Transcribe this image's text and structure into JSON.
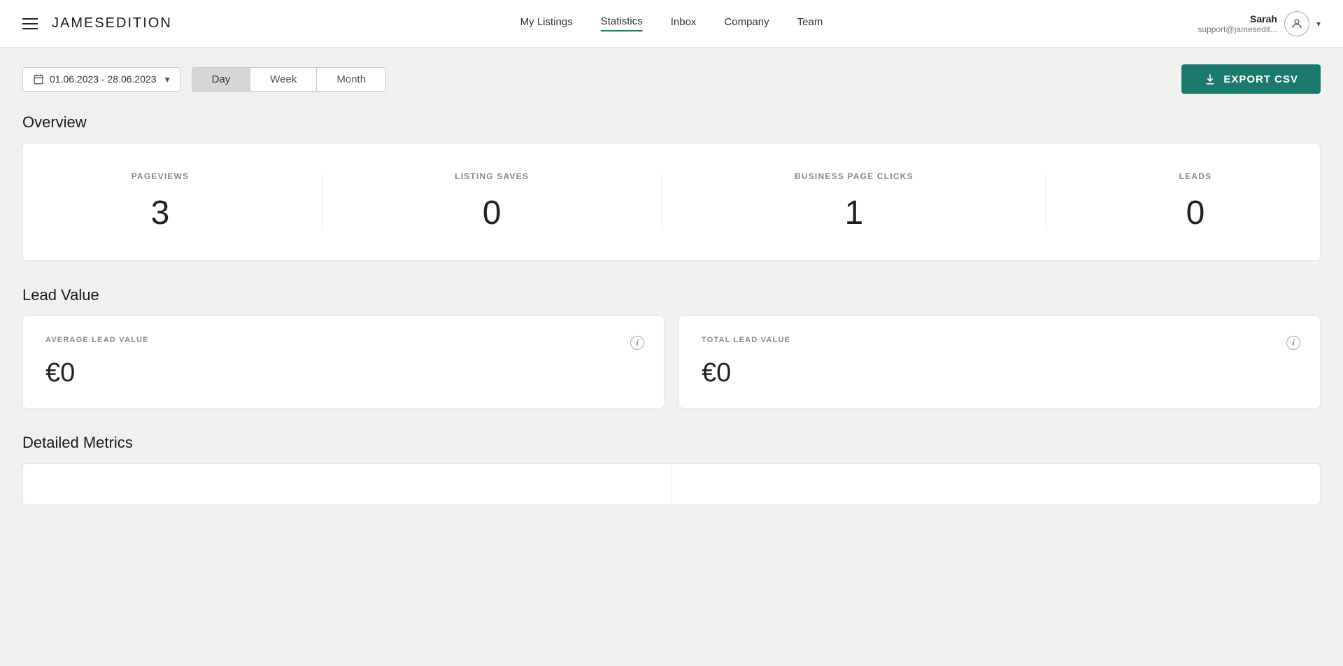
{
  "header": {
    "logo": "JamesEdition",
    "nav": [
      {
        "label": "My Listings",
        "active": false
      },
      {
        "label": "Statistics",
        "active": true
      },
      {
        "label": "Inbox",
        "active": false
      },
      {
        "label": "Company",
        "active": false
      },
      {
        "label": "Team",
        "active": false
      }
    ],
    "user": {
      "name": "Sarah",
      "email": "support@jamesedit..."
    }
  },
  "toolbar": {
    "date_range": "01.06.2023 - 28.06.2023",
    "period_buttons": [
      {
        "label": "Day",
        "active": true
      },
      {
        "label": "Week",
        "active": false
      },
      {
        "label": "Month",
        "active": false
      }
    ],
    "export_label": "EXPORT CSV"
  },
  "overview": {
    "title": "Overview",
    "metrics": [
      {
        "label": "PAGEVIEWS",
        "value": "3"
      },
      {
        "label": "LISTING SAVES",
        "value": "0"
      },
      {
        "label": "BUSINESS PAGE CLICKS",
        "value": "1"
      },
      {
        "label": "LEADS",
        "value": "0"
      }
    ]
  },
  "lead_value": {
    "title": "Lead Value",
    "cards": [
      {
        "label": "AVERAGE LEAD VALUE",
        "value": "€0"
      },
      {
        "label": "TOTAL LEAD VALUE",
        "value": "€0"
      }
    ]
  },
  "detailed_metrics": {
    "title": "Detailed Metrics"
  }
}
